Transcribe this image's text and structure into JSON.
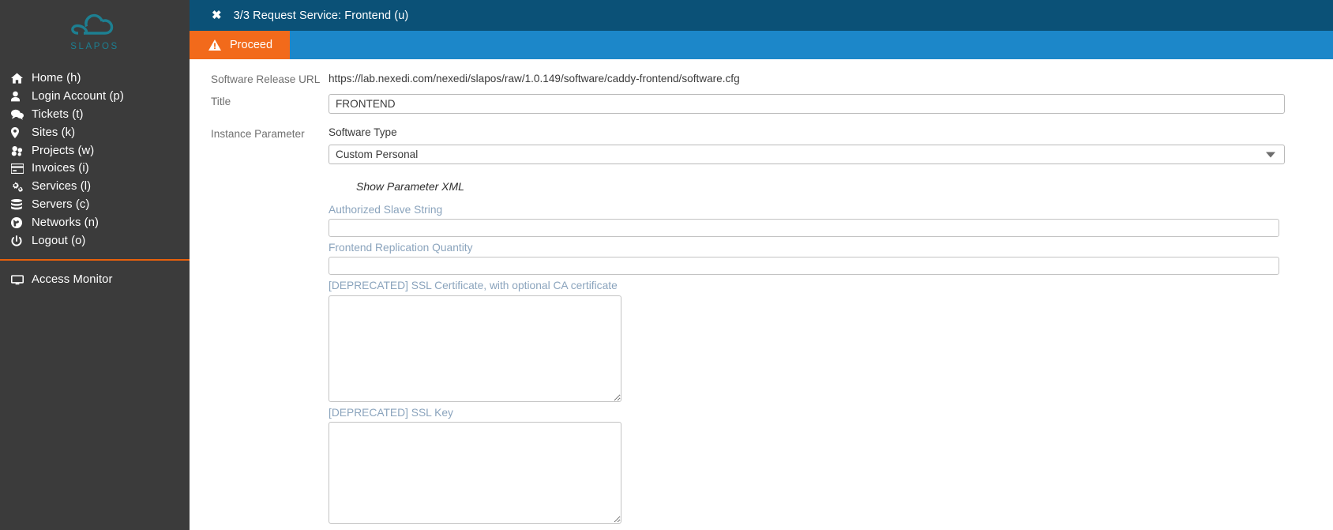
{
  "sidebar": {
    "logo_text": "SLAPOS",
    "logo_color": "#1d7f91",
    "background": "#3b3b3b",
    "divider_color": "#e8600b",
    "items": [
      {
        "label": "Home (h)",
        "icon": "home-icon"
      },
      {
        "label": "Login Account (p)",
        "icon": "user-icon"
      },
      {
        "label": "Tickets (t)",
        "icon": "comments-icon"
      },
      {
        "label": "Sites (k)",
        "icon": "map-pin-icon"
      },
      {
        "label": "Projects (w)",
        "icon": "cubes-icon"
      },
      {
        "label": "Invoices (i)",
        "icon": "credit-card-icon"
      },
      {
        "label": "Services (l)",
        "icon": "gears-icon"
      },
      {
        "label": "Servers (c)",
        "icon": "database-icon"
      },
      {
        "label": "Networks (n)",
        "icon": "globe-icon"
      },
      {
        "label": "Logout (o)",
        "icon": "power-icon"
      }
    ],
    "bottom_items": [
      {
        "label": "Access Monitor",
        "icon": "monitor-icon"
      }
    ]
  },
  "header": {
    "close_glyph": "✖",
    "title": "3/3 Request Service: Frontend (u)",
    "background": "#0b5177",
    "actionbar_background": "#1c87c9",
    "proceed_label": "Proceed",
    "proceed_color": "#f26a1b",
    "warning_icon": "warning-triangle-icon"
  },
  "form": {
    "software_release_url_label": "Software Release URL",
    "software_release_url_value": "https://lab.nexedi.com/nexedi/slapos/raw/1.0.149/software/caddy-frontend/software.cfg",
    "title_label": "Title",
    "title_value": "FRONTEND",
    "title_placeholder": "",
    "instance_parameter_label": "Instance Parameter",
    "software_type_label": "Software Type",
    "software_type_value": "Custom Personal",
    "software_type_options": [
      "Custom Personal"
    ],
    "show_parameter_xml_label": "Show Parameter XML",
    "parameters": [
      {
        "label": "Authorized Slave String",
        "value": "",
        "placeholder": "",
        "field": "input",
        "name": "authorized-slave-string"
      },
      {
        "label": "Frontend Replication Quantity",
        "value": "",
        "placeholder": "",
        "field": "input",
        "name": "frontend-replication-quantity"
      },
      {
        "label": "[DEPRECATED] SSL Certificate, with optional CA certificate",
        "value": "",
        "placeholder": "",
        "field": "textarea",
        "name": "deprecated-ssl-certificate"
      },
      {
        "label": "[DEPRECATED] SSL Key",
        "value": "",
        "placeholder": "",
        "field": "textarea",
        "name": "deprecated-ssl-key"
      }
    ]
  }
}
